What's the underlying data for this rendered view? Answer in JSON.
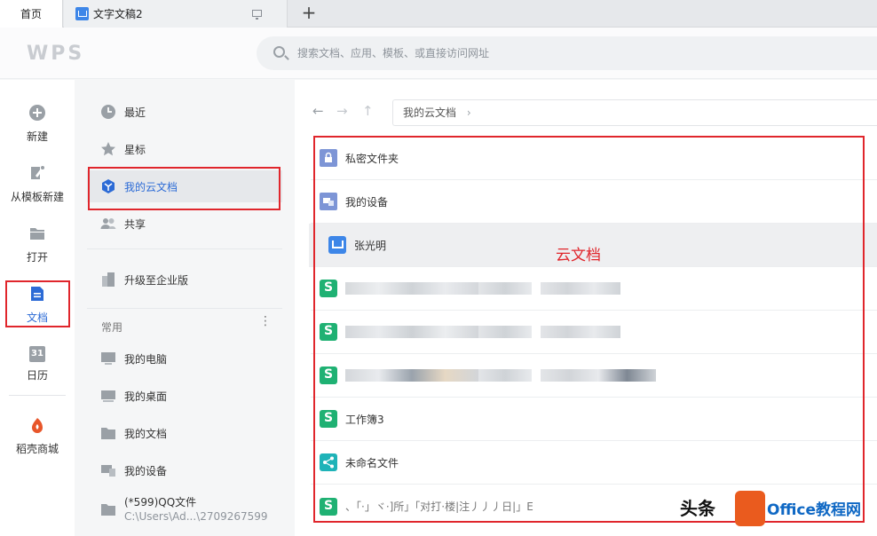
{
  "tabs": {
    "home_label": "首页",
    "doc_label": "文字文稿2",
    "new_tab_symbol": "+"
  },
  "header": {
    "logo_text": "WPS",
    "search_placeholder": "搜索文档、应用、模板、或直接访问网址"
  },
  "leftbar": {
    "items": [
      {
        "label": "新建",
        "icon": "plus-circle-icon"
      },
      {
        "label": "从模板新建",
        "icon": "template-icon"
      },
      {
        "label": "打开",
        "icon": "folder-open-icon"
      },
      {
        "label": "文档",
        "icon": "document-icon"
      },
      {
        "label": "日历",
        "icon": "calendar-icon",
        "day": "31"
      },
      {
        "label": "稻壳商城",
        "icon": "docer-store-icon"
      }
    ]
  },
  "nav": {
    "items": [
      {
        "label": "最近",
        "icon": "clock-icon"
      },
      {
        "label": "星标",
        "icon": "star-icon"
      },
      {
        "label": "我的云文档",
        "icon": "cloud-cube-icon"
      },
      {
        "label": "共享",
        "icon": "people-icon"
      },
      {
        "label": "升级至企业版",
        "icon": "building-icon"
      }
    ],
    "common_header": "常用",
    "common_items": [
      {
        "label": "我的电脑",
        "icon": "computer-icon"
      },
      {
        "label": "我的桌面",
        "icon": "desktop-icon"
      },
      {
        "label": "我的文档",
        "icon": "folder-icon"
      },
      {
        "label": "我的设备",
        "icon": "device-icon"
      },
      {
        "label": "(*599)QQ文件",
        "sub": "C:\\Users\\Ad...\\2709267599",
        "icon": "folder-icon"
      }
    ]
  },
  "main": {
    "breadcrumb": "我的云文档",
    "files": [
      {
        "name": "私密文件夹",
        "type": "locked-folder"
      },
      {
        "name": "我的设备",
        "type": "device-folder"
      },
      {
        "name": "张光明",
        "type": "writer"
      },
      {
        "name": "",
        "type": "spreadsheet"
      },
      {
        "name": "",
        "type": "spreadsheet"
      },
      {
        "name": "",
        "type": "spreadsheet"
      },
      {
        "name": "工作簿3",
        "type": "spreadsheet"
      },
      {
        "name": "未命名文件",
        "type": "share"
      },
      {
        "name": "、「·」ヾ·]所」「对打·楼|注丿丿丿日|」E",
        "type": "spreadsheet"
      }
    ],
    "annotation": "云文档"
  },
  "watermark": {
    "toutiao": "头条",
    "brand": "Office教程网"
  },
  "colors": {
    "accent": "#2c6bd6",
    "highlight_box": "#e0262c",
    "spreadsheet_icon": "#1fb173",
    "writer_icon": "#3d86e8"
  }
}
